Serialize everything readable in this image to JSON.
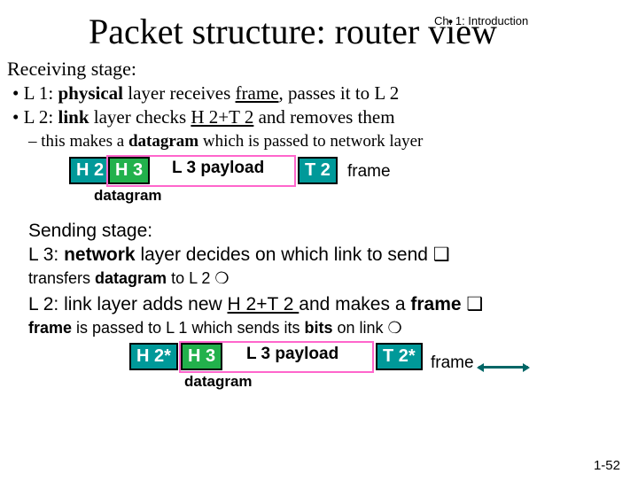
{
  "chapter": "Ch. 1: Introduction",
  "title": "Packet structure: router view",
  "recv": {
    "head": "Receiving stage:",
    "b1_prefix": "•  L 1: ",
    "b1_bold": "physical",
    "b1_mid": " layer receives ",
    "b1_u": "frame",
    "b1_suffix": ", passes it to L 2",
    "b2_prefix": "•  L 2: ",
    "b2_bold": "link",
    "b2_mid": " layer checks ",
    "b2_u": "H 2+T 2",
    "b2_suffix": " and removes them",
    "sub_prefix": "–  this makes a ",
    "sub_bold": "datagram",
    "sub_suffix": " which is passed to network layer"
  },
  "diag1": {
    "h2": "H 2",
    "h3": "H 3",
    "payload": "L 3 payload",
    "t2": "T 2",
    "datagram": "datagram",
    "frame": "frame"
  },
  "send": {
    "head": "Sending stage:",
    "l3_prefix": "L 3: ",
    "l3_bold": "network",
    "l3_suffix": " layer decides on which link to send ❑",
    "xfer_prefix": "transfers ",
    "xfer_bold": "datagram",
    "xfer_suffix": " to L 2 ❍",
    "l2_prefix": "L 2: link layer adds new ",
    "l2_u": "H 2+T 2 ",
    "l2_mid": "and makes a ",
    "l2_bold": "frame",
    "l2_suffix": " ❑",
    "fp_bold1": "frame",
    "fp_mid": " is passed to L 1 which sends its ",
    "fp_bold2": "bits",
    "fp_suffix": " on link  ❍"
  },
  "diag2": {
    "h2": "H 2*",
    "h3": "H 3",
    "payload": "L 3 payload",
    "t2": "T 2*",
    "datagram": "datagram",
    "frame": "frame"
  },
  "pagenum": "1-52"
}
